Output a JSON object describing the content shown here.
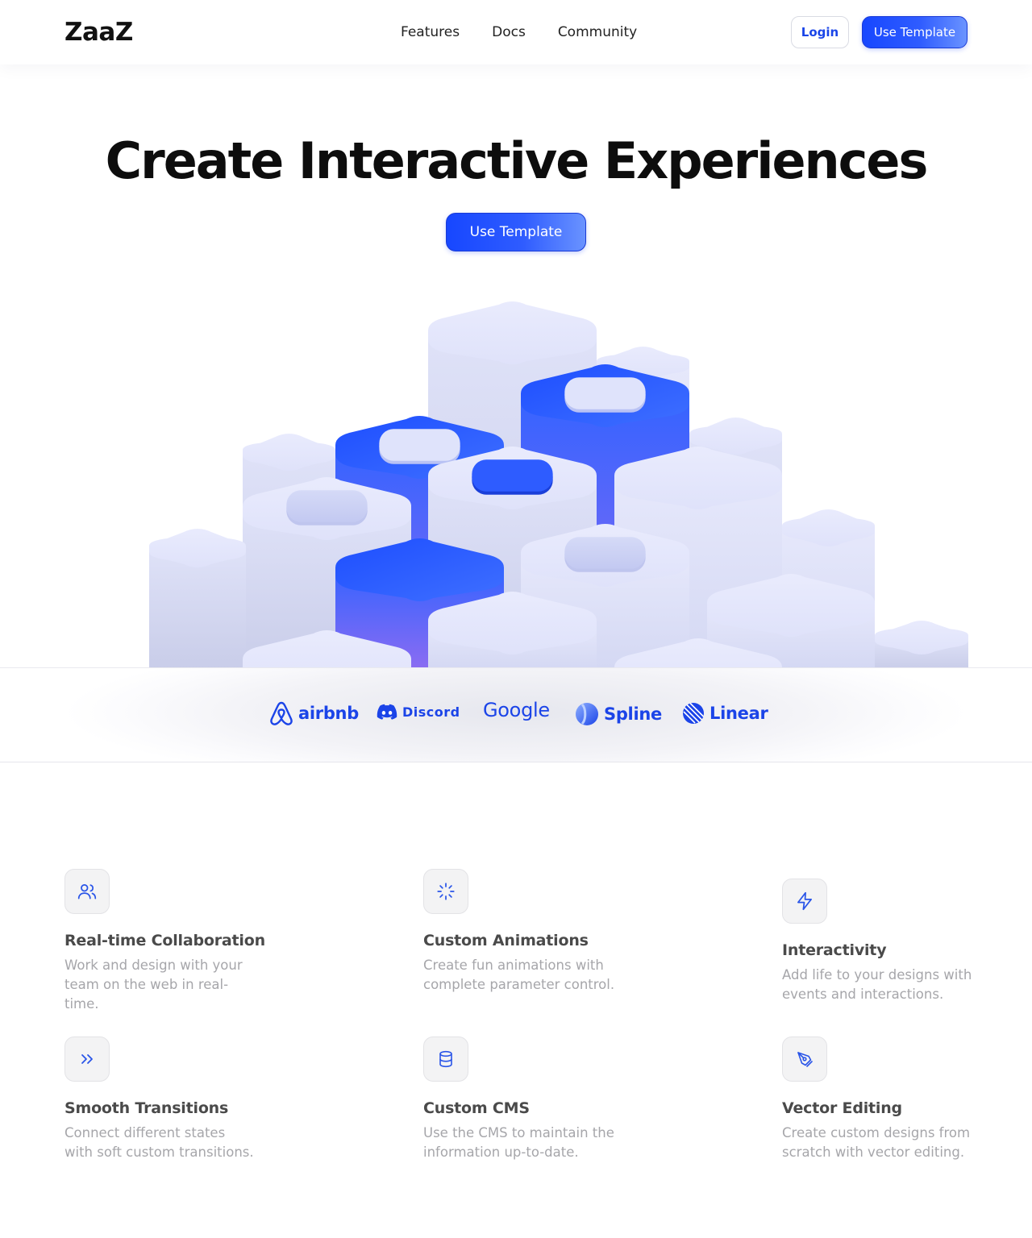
{
  "header": {
    "logo": "ZaaZ",
    "nav": [
      "Features",
      "Docs",
      "Community"
    ],
    "login_label": "Login",
    "cta_label": "Use Template"
  },
  "hero": {
    "title": "Create Interactive Experiences",
    "cta_label": "Use Template"
  },
  "logos": [
    {
      "name": "airbnb",
      "icon": "airbnb-icon"
    },
    {
      "name": "Discord",
      "icon": "discord-icon"
    },
    {
      "name": "Google",
      "icon": "none"
    },
    {
      "name": "Spline",
      "icon": "spline-icon"
    },
    {
      "name": "Linear",
      "icon": "linear-icon"
    }
  ],
  "features": [
    {
      "title": "Real-time Collaboration",
      "desc": "Work and design with your team on the web in real-time.",
      "icon": "users-icon"
    },
    {
      "title": "Custom Animations",
      "desc": "Create fun animations with complete parameter control.",
      "icon": "loader-icon"
    },
    {
      "title": "Interactivity",
      "desc": "Add life to your designs with events and interactions.",
      "icon": "lightning-icon"
    },
    {
      "title": "Smooth Transitions",
      "desc": "Connect different states with soft custom transitions.",
      "icon": "chevrons-right-icon"
    },
    {
      "title": "Custom CMS",
      "desc": "Use the CMS to maintain the information up-to-date.",
      "icon": "database-icon"
    },
    {
      "title": "Vector Editing",
      "desc": "Create custom designs from scratch with vector editing.",
      "icon": "pen-tool-icon"
    }
  ],
  "colors": {
    "accent": "#1747ff",
    "accent_light": "#6a93ff",
    "block_light": "#e2e5fb",
    "block_blue": "#2e63ff"
  }
}
